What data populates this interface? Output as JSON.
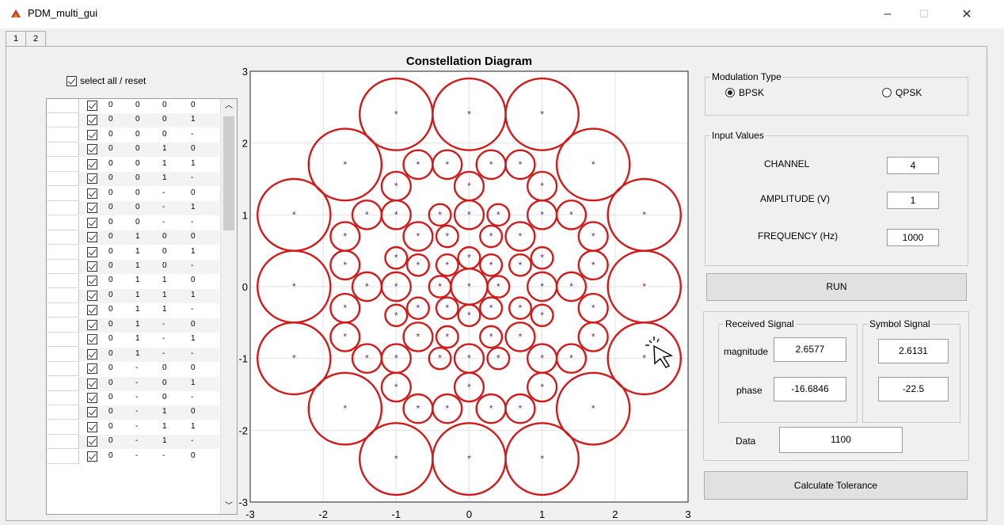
{
  "window": {
    "title": "PDM_multi_gui",
    "minimize": "–",
    "maximize": "☐",
    "close": "✕"
  },
  "tabs": [
    "1",
    "2"
  ],
  "select_all_label": "select all / reset",
  "table_rows": [
    [
      "0",
      "0",
      "0",
      "0"
    ],
    [
      "0",
      "0",
      "0",
      "1"
    ],
    [
      "0",
      "0",
      "0",
      "-"
    ],
    [
      "0",
      "0",
      "1",
      "0"
    ],
    [
      "0",
      "0",
      "1",
      "1"
    ],
    [
      "0",
      "0",
      "1",
      "-"
    ],
    [
      "0",
      "0",
      "-",
      "0"
    ],
    [
      "0",
      "0",
      "-",
      "1"
    ],
    [
      "0",
      "0",
      "-",
      "-"
    ],
    [
      "0",
      "1",
      "0",
      "0"
    ],
    [
      "0",
      "1",
      "0",
      "1"
    ],
    [
      "0",
      "1",
      "0",
      "-"
    ],
    [
      "0",
      "1",
      "1",
      "0"
    ],
    [
      "0",
      "1",
      "1",
      "1"
    ],
    [
      "0",
      "1",
      "1",
      "-"
    ],
    [
      "0",
      "1",
      "-",
      "0"
    ],
    [
      "0",
      "1",
      "-",
      "1"
    ],
    [
      "0",
      "1",
      "-",
      "-"
    ],
    [
      "0",
      "-",
      "0",
      "0"
    ],
    [
      "0",
      "-",
      "0",
      "1"
    ],
    [
      "0",
      "-",
      "0",
      "-"
    ],
    [
      "0",
      "-",
      "1",
      "0"
    ],
    [
      "0",
      "-",
      "1",
      "1"
    ],
    [
      "0",
      "-",
      "1",
      "-"
    ],
    [
      "0",
      "-",
      "-",
      "0"
    ]
  ],
  "chart_data": {
    "type": "scatter",
    "title": "Constellation Diagram",
    "xlim": [
      -3,
      3
    ],
    "ylim": [
      -3,
      3
    ],
    "xticks": [
      -3,
      -2,
      -1,
      0,
      1,
      2,
      3
    ],
    "yticks": [
      3,
      2,
      1,
      0,
      -1,
      -2,
      -3
    ],
    "grid": true,
    "marker_color": "#5b2c8a",
    "circle_color": "#d11a1a",
    "points": [
      {
        "x": -1,
        "y": 2.4,
        "r": 0.5
      },
      {
        "x": 0,
        "y": 2.4,
        "r": 0.5
      },
      {
        "x": 1,
        "y": 2.4,
        "r": 0.5
      },
      {
        "x": -1.7,
        "y": 1.7,
        "r": 0.5
      },
      {
        "x": 1.7,
        "y": 1.7,
        "r": 0.5
      },
      {
        "x": -2.4,
        "y": 1,
        "r": 0.5
      },
      {
        "x": 2.4,
        "y": 1,
        "r": 0.5
      },
      {
        "x": -2.4,
        "y": 0,
        "r": 0.5
      },
      {
        "x": 2.4,
        "y": 0,
        "r": 0.5
      },
      {
        "x": -2.4,
        "y": -1,
        "r": 0.5
      },
      {
        "x": 2.4,
        "y": -1,
        "r": 0.5
      },
      {
        "x": -1.7,
        "y": -1.7,
        "r": 0.5
      },
      {
        "x": 1.7,
        "y": -1.7,
        "r": 0.5
      },
      {
        "x": -1,
        "y": -2.4,
        "r": 0.5
      },
      {
        "x": 0,
        "y": -2.4,
        "r": 0.5
      },
      {
        "x": 1,
        "y": -2.4,
        "r": 0.5
      },
      {
        "x": -0.7,
        "y": 1.7,
        "r": 0.2
      },
      {
        "x": -0.3,
        "y": 1.7,
        "r": 0.2
      },
      {
        "x": 0.3,
        "y": 1.7,
        "r": 0.2
      },
      {
        "x": 0.7,
        "y": 1.7,
        "r": 0.2
      },
      {
        "x": -1,
        "y": 1.4,
        "r": 0.2
      },
      {
        "x": 0,
        "y": 1.4,
        "r": 0.2
      },
      {
        "x": 1,
        "y": 1.4,
        "r": 0.2
      },
      {
        "x": -1.4,
        "y": 1,
        "r": 0.2
      },
      {
        "x": -1,
        "y": 1,
        "r": 0.2
      },
      {
        "x": -0.4,
        "y": 1,
        "r": 0.15
      },
      {
        "x": 0,
        "y": 1,
        "r": 0.2
      },
      {
        "x": 0.4,
        "y": 1,
        "r": 0.15
      },
      {
        "x": 1,
        "y": 1,
        "r": 0.2
      },
      {
        "x": 1.4,
        "y": 1,
        "r": 0.2
      },
      {
        "x": -1.7,
        "y": 0.7,
        "r": 0.2
      },
      {
        "x": -0.7,
        "y": 0.7,
        "r": 0.2
      },
      {
        "x": -0.3,
        "y": 0.7,
        "r": 0.15
      },
      {
        "x": 0.3,
        "y": 0.7,
        "r": 0.15
      },
      {
        "x": 0.7,
        "y": 0.7,
        "r": 0.2
      },
      {
        "x": 1.7,
        "y": 0.7,
        "r": 0.2
      },
      {
        "x": -1,
        "y": 0.4,
        "r": 0.15
      },
      {
        "x": 0,
        "y": 0.4,
        "r": 0.15
      },
      {
        "x": 1,
        "y": 0.4,
        "r": 0.15
      },
      {
        "x": -1.7,
        "y": 0.3,
        "r": 0.2
      },
      {
        "x": -0.7,
        "y": 0.3,
        "r": 0.15
      },
      {
        "x": -0.3,
        "y": 0.3,
        "r": 0.15
      },
      {
        "x": 0.3,
        "y": 0.3,
        "r": 0.15
      },
      {
        "x": 0.7,
        "y": 0.3,
        "r": 0.15
      },
      {
        "x": 1.7,
        "y": 0.3,
        "r": 0.2
      },
      {
        "x": -1.4,
        "y": 0,
        "r": 0.2
      },
      {
        "x": -1,
        "y": 0,
        "r": 0.2
      },
      {
        "x": -0.4,
        "y": 0,
        "r": 0.15
      },
      {
        "x": 0,
        "y": 0,
        "r": 0.25
      },
      {
        "x": 0.4,
        "y": 0,
        "r": 0.15
      },
      {
        "x": 1,
        "y": 0,
        "r": 0.2
      },
      {
        "x": 1.4,
        "y": 0,
        "r": 0.2
      },
      {
        "x": -1.7,
        "y": -0.3,
        "r": 0.2
      },
      {
        "x": -0.7,
        "y": -0.3,
        "r": 0.15
      },
      {
        "x": -0.3,
        "y": -0.3,
        "r": 0.15
      },
      {
        "x": 0.3,
        "y": -0.3,
        "r": 0.15
      },
      {
        "x": 0.7,
        "y": -0.3,
        "r": 0.15
      },
      {
        "x": 1.7,
        "y": -0.3,
        "r": 0.2
      },
      {
        "x": -1,
        "y": -0.4,
        "r": 0.15
      },
      {
        "x": 0,
        "y": -0.4,
        "r": 0.15
      },
      {
        "x": 1,
        "y": -0.4,
        "r": 0.15
      },
      {
        "x": -1.7,
        "y": -0.7,
        "r": 0.2
      },
      {
        "x": -0.7,
        "y": -0.7,
        "r": 0.2
      },
      {
        "x": -0.3,
        "y": -0.7,
        "r": 0.15
      },
      {
        "x": 0.3,
        "y": -0.7,
        "r": 0.15
      },
      {
        "x": 0.7,
        "y": -0.7,
        "r": 0.2
      },
      {
        "x": 1.7,
        "y": -0.7,
        "r": 0.2
      },
      {
        "x": -1.4,
        "y": -1,
        "r": 0.2
      },
      {
        "x": -1,
        "y": -1,
        "r": 0.2
      },
      {
        "x": -0.4,
        "y": -1,
        "r": 0.15
      },
      {
        "x": 0,
        "y": -1,
        "r": 0.2
      },
      {
        "x": 0.4,
        "y": -1,
        "r": 0.15
      },
      {
        "x": 1,
        "y": -1,
        "r": 0.2
      },
      {
        "x": 1.4,
        "y": -1,
        "r": 0.2
      },
      {
        "x": -1,
        "y": -1.4,
        "r": 0.2
      },
      {
        "x": 0,
        "y": -1.4,
        "r": 0.2
      },
      {
        "x": 1,
        "y": -1.4,
        "r": 0.2
      },
      {
        "x": -0.7,
        "y": -1.7,
        "r": 0.2
      },
      {
        "x": -0.3,
        "y": -1.7,
        "r": 0.2
      },
      {
        "x": 0.3,
        "y": -1.7,
        "r": 0.2
      },
      {
        "x": 0.7,
        "y": -1.7,
        "r": 0.2
      }
    ]
  },
  "modulation": {
    "label": "Modulation Type",
    "options": [
      "BPSK",
      "QPSK"
    ],
    "selected": "BPSK"
  },
  "inputs": {
    "label": "Input Values",
    "channel_label": "CHANNEL",
    "channel": "4",
    "amplitude_label": "AMPLITUDE  (V)",
    "amplitude": "1",
    "frequency_label": "FREQUENCY (Hz)",
    "frequency": "1000"
  },
  "run_label": "RUN",
  "received": {
    "label": "Received Signal",
    "magnitude_label": "magnitude",
    "magnitude": "2.6577",
    "phase_label": "phase",
    "phase": "-16.6846"
  },
  "symbol": {
    "label": "Symbol Signal",
    "magnitude": "2.6131",
    "phase": "-22.5"
  },
  "data_label": "Data",
  "data_value": "1100",
  "calc_label": "Calculate Tolerance"
}
